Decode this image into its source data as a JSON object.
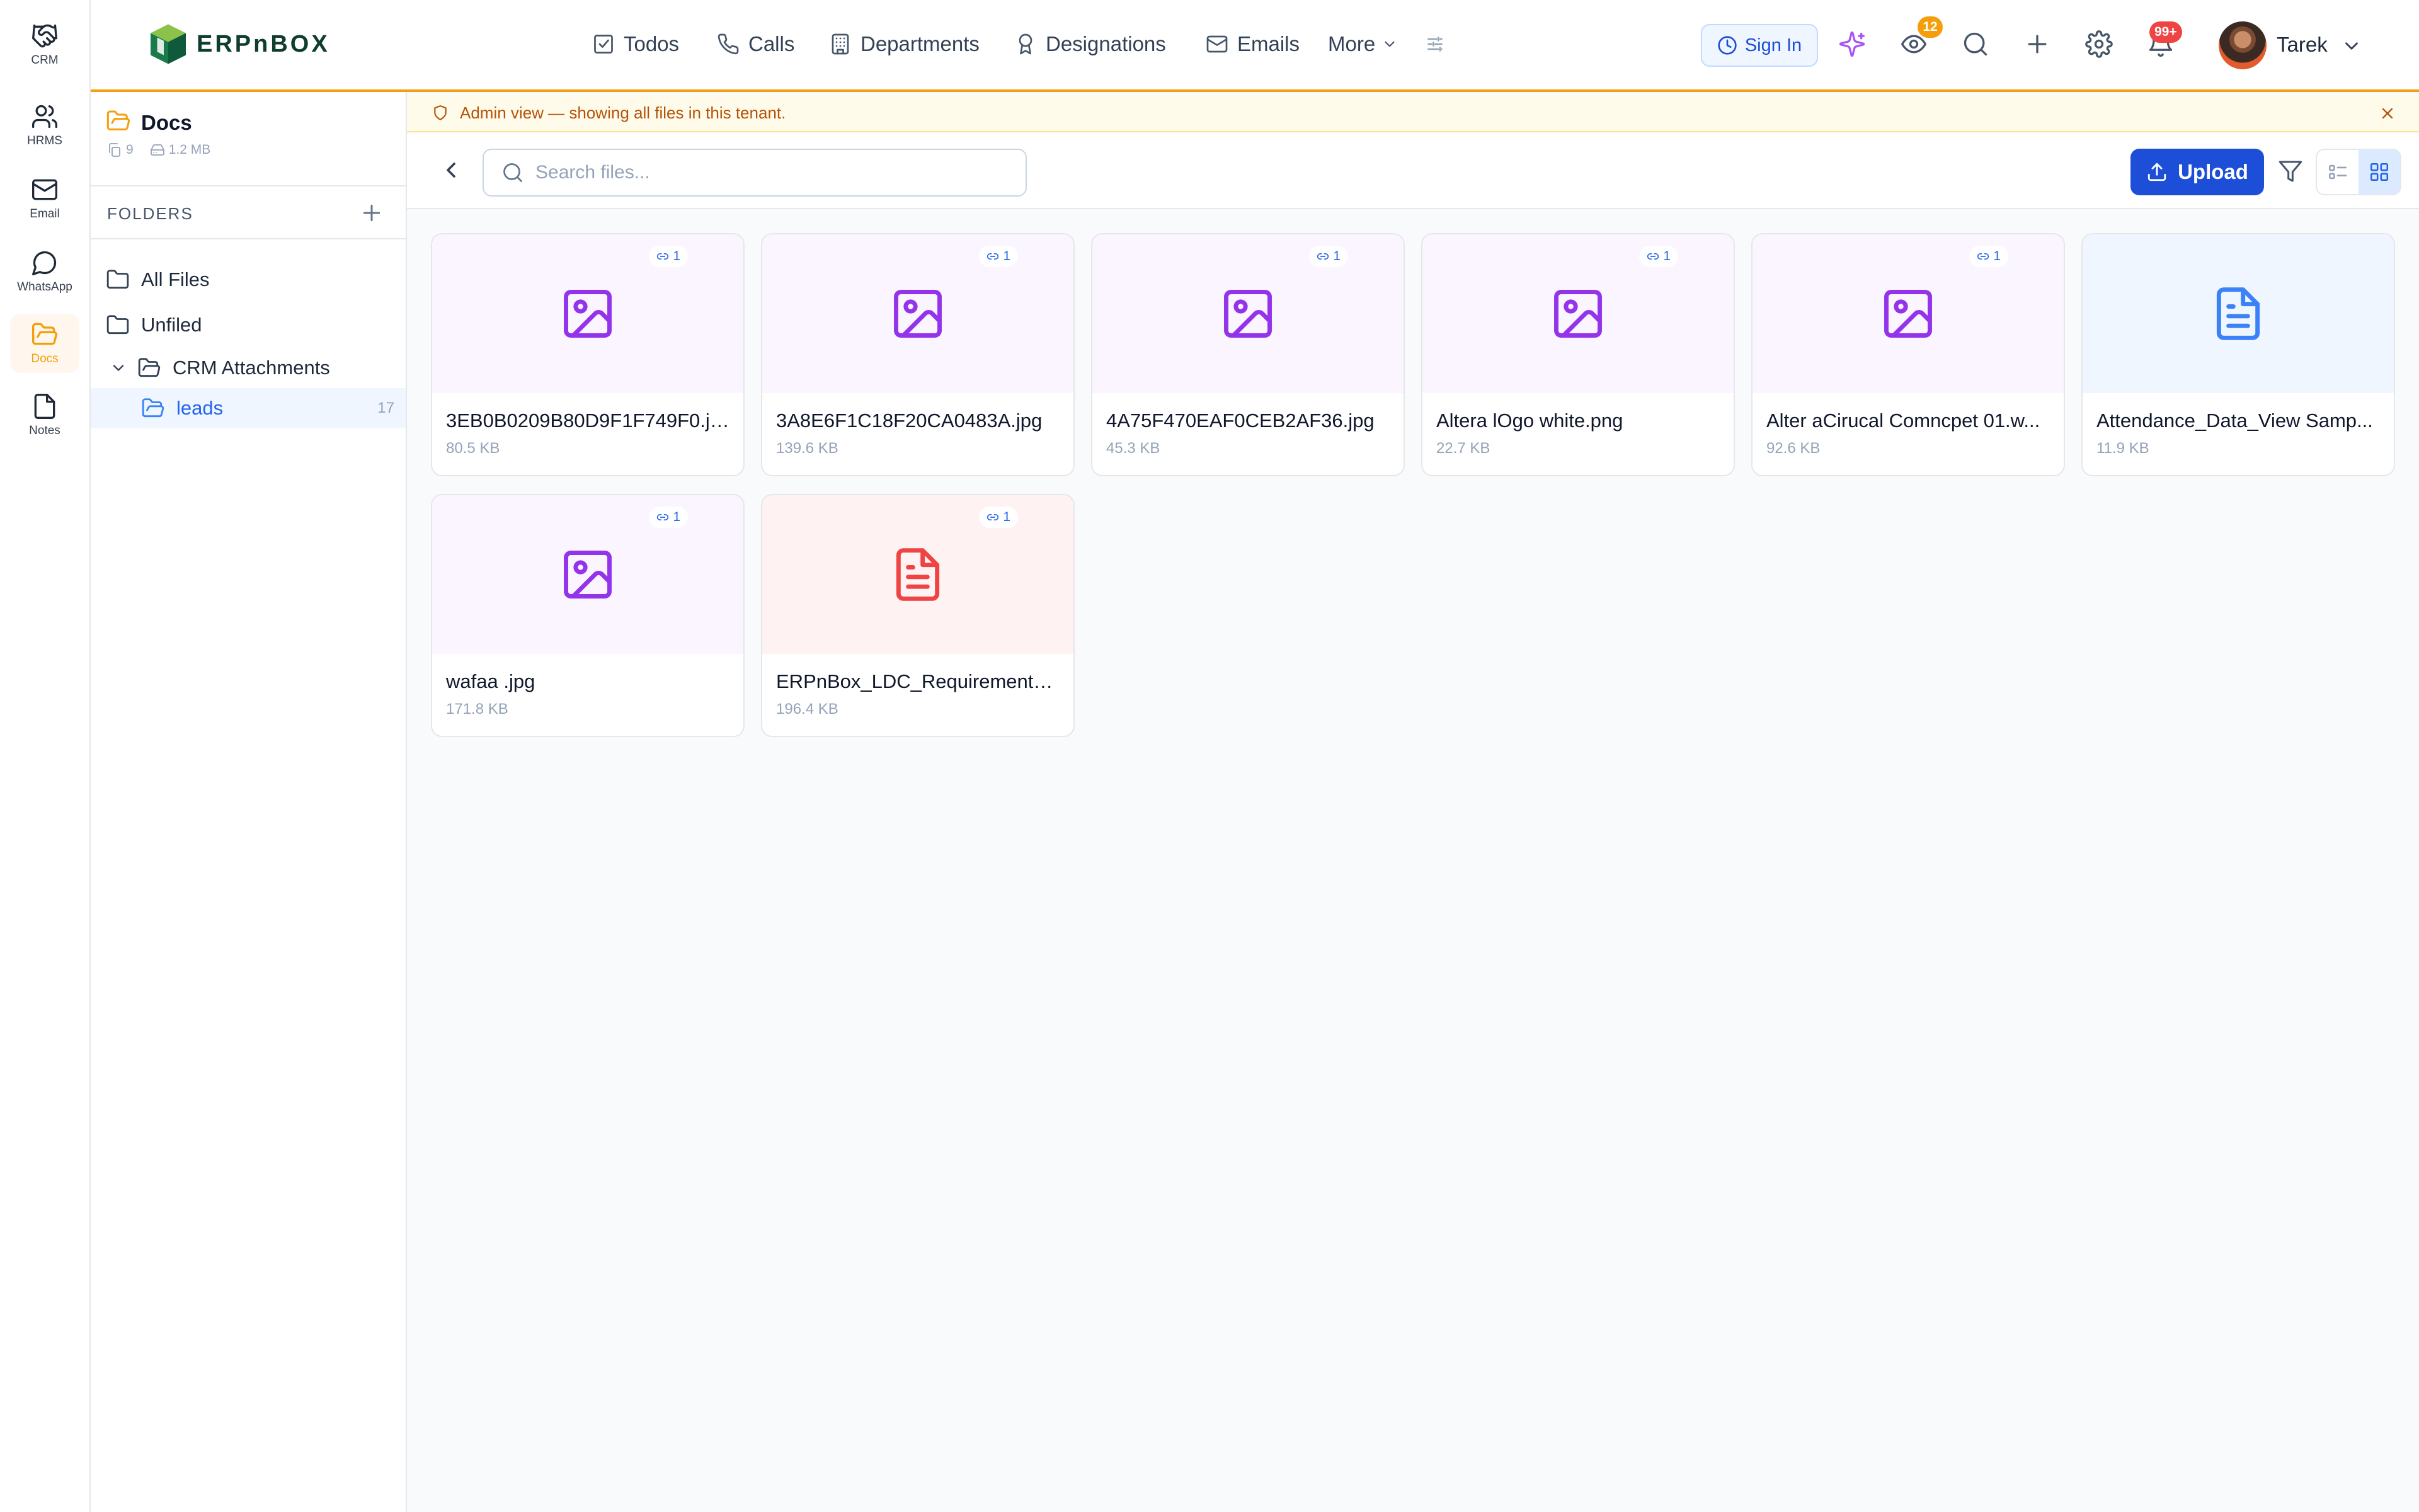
{
  "rail": {
    "items": [
      {
        "label": "CRM",
        "icon": "handshake-icon"
      },
      {
        "label": "HRMS",
        "icon": "users-icon"
      },
      {
        "label": "Email",
        "icon": "mail-icon"
      },
      {
        "label": "WhatsApp",
        "icon": "chat-bubble-icon"
      },
      {
        "label": "Docs",
        "icon": "folder-open-icon",
        "active": true
      },
      {
        "label": "Notes",
        "icon": "file-icon"
      }
    ]
  },
  "header": {
    "brand": "ERPnBOX",
    "nav": [
      {
        "label": "Todos",
        "icon": "checkbox-icon"
      },
      {
        "label": "Calls",
        "icon": "phone-icon"
      },
      {
        "label": "Departments",
        "icon": "building-icon"
      },
      {
        "label": "Designations",
        "icon": "award-icon"
      },
      {
        "label": "Emails",
        "icon": "mail-icon"
      }
    ],
    "more_label": "More",
    "sign_in_label": "Sign In",
    "watch_badge": "12",
    "notif_badge": "99+",
    "user_name": "Tarek"
  },
  "folders_panel": {
    "title": "Docs",
    "file_count": "9",
    "size": "1.2 MB",
    "section_label": "FOLDERS",
    "tree": [
      {
        "label": "All Files"
      },
      {
        "label": "Unfiled"
      },
      {
        "label": "CRM Attachments",
        "expanded": true
      },
      {
        "label": "leads",
        "count": "17",
        "active": true
      }
    ]
  },
  "banner": {
    "text": "Admin view — showing all files in this tenant."
  },
  "toolbar": {
    "search_placeholder": "Search files...",
    "upload_label": "Upload"
  },
  "files": [
    {
      "name": "3EB0B0209B80D9F1F749F0.jpg",
      "size": "80.5 KB",
      "kind": "image",
      "links": "1"
    },
    {
      "name": "3A8E6F1C18F20CA0483A.jpg",
      "size": "139.6 KB",
      "kind": "image",
      "links": "1"
    },
    {
      "name": "4A75F470EAF0CEB2AF36.jpg",
      "size": "45.3 KB",
      "kind": "image",
      "links": "1"
    },
    {
      "name": "Altera lOgo white.png",
      "size": "22.7 KB",
      "kind": "image",
      "links": "1"
    },
    {
      "name": "Alter aCirucal Comncpet 01.w...",
      "size": "92.6 KB",
      "kind": "image",
      "links": "1"
    },
    {
      "name": "Attendance_Data_View Samp...",
      "size": "11.9 KB",
      "kind": "document",
      "links": ""
    },
    {
      "name": "wafaa .jpg",
      "size": "171.8 KB",
      "kind": "image",
      "links": "1"
    },
    {
      "name": "ERPnBox_LDC_Requirements....",
      "size": "196.4 KB",
      "kind": "pdf",
      "links": "1"
    }
  ],
  "colors": {
    "accent": "#f59e0b",
    "primary": "#1d4ed8",
    "image_tint": "#9333ea",
    "doc_tint": "#3b82f6",
    "pdf_tint": "#ef4444"
  }
}
